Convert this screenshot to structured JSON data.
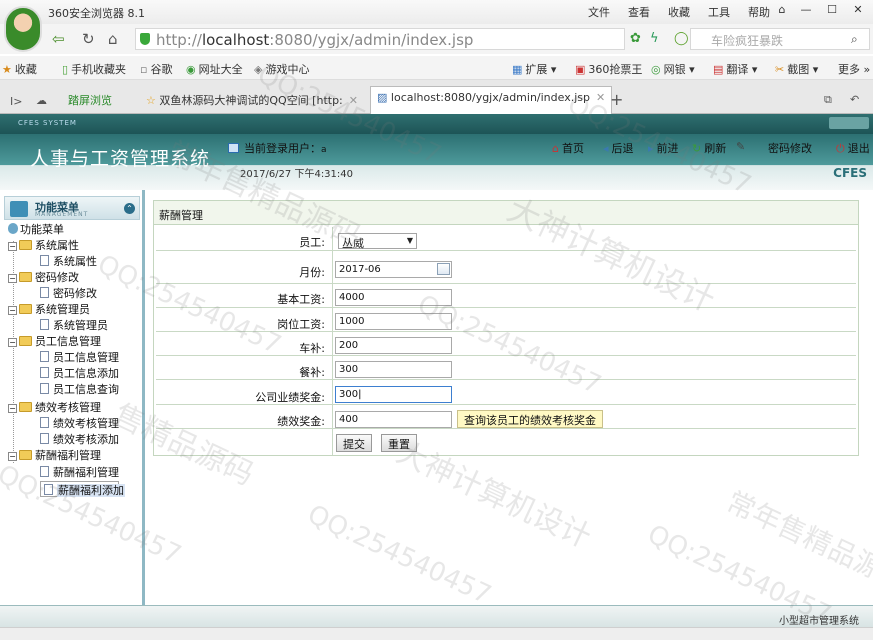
{
  "browser": {
    "title": "360安全浏览器 8.1",
    "menu": [
      "文件",
      "查看",
      "收藏",
      "工具",
      "帮助"
    ],
    "url_prefix": "http://",
    "url_host": "localhost",
    "url_rest": ":8080/ygjx/admin/index.jsp",
    "search_placeholder": "车险疯狂暴跌",
    "bookmarks": [
      "收藏",
      "手机收藏夹",
      "谷歌",
      "网址大全",
      "游戏中心"
    ],
    "bookmarks_right": [
      "扩展",
      "360抢票王",
      "网银",
      "翻译",
      "截图",
      "更多"
    ],
    "tabs": [
      "踏屏浏览",
      "双鱼林源码大神调试的QQ空间 [http:",
      "localhost:8080/ygjx/admin/index.jsp"
    ]
  },
  "app": {
    "sys_label": "CFES SYSTEM",
    "title": "人事与工资管理系统",
    "current_user_label": "当前登录用户：",
    "current_user": "a",
    "datetime": "2017/6/27 下午4:31:40",
    "nav": [
      "首页",
      "后退",
      "前进",
      "刷新",
      "密码修改",
      "退出"
    ],
    "brand": "CFES"
  },
  "menu": {
    "title": "功能菜单",
    "subtitle": "MANAGEMENT",
    "root": "功能菜单",
    "groups": [
      {
        "label": "系统属性",
        "items": [
          "系统属性"
        ]
      },
      {
        "label": "密码修改",
        "items": [
          "密码修改"
        ]
      },
      {
        "label": "系统管理员",
        "items": [
          "系统管理员"
        ]
      },
      {
        "label": "员工信息管理",
        "items": [
          "员工信息管理",
          "员工信息添加",
          "员工信息查询"
        ]
      },
      {
        "label": "绩效考核管理",
        "items": [
          "绩效考核管理",
          "绩效考核添加"
        ]
      },
      {
        "label": "薪酬福利管理",
        "items": [
          "薪酬福利管理",
          "薪酬福利添加"
        ]
      }
    ]
  },
  "form": {
    "section_title": "薪酬管理",
    "employee_label": "员工:",
    "employee_value": "丛威",
    "month_label": "月份:",
    "month_value": "2017-06",
    "base_salary_label": "基本工资:",
    "base_salary_value": "4000",
    "post_salary_label": "岗位工资:",
    "post_salary_value": "1000",
    "car_allowance_label": "车补:",
    "car_allowance_value": "200",
    "meal_allowance_label": "餐补:",
    "meal_allowance_value": "300",
    "company_bonus_label": "公司业绩奖金:",
    "company_bonus_value": "300",
    "perf_bonus_label": "绩效奖金:",
    "perf_bonus_value": "400",
    "query_button": "查询该员工的绩效考核奖金",
    "submit": "提交",
    "reset": "重置"
  },
  "footer": {
    "right_text": "小型超市管理系统"
  },
  "watermarks": [
    "QQ:254540457",
    "大神计算机设计",
    "常年售精品源码",
    "售精品源码"
  ]
}
